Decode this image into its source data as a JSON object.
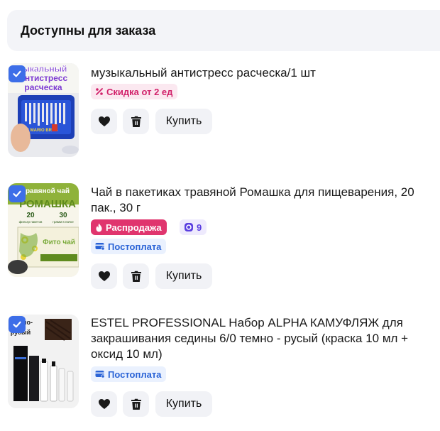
{
  "section": {
    "title": "Доступны для заказа"
  },
  "items": [
    {
      "title": "музыкальный антистресс расческа/1 шт",
      "badges": {
        "discount": "Скидка от 2 ед"
      },
      "image_text": {
        "line1": "ыкальный",
        "line2": "нтистресс",
        "line3": "расческа",
        "brand": "SUPER MARIO BROS"
      },
      "buy_label": "Купить"
    },
    {
      "title": "Чай в пакетиках травяной Ромашка для пищеварения, 20 пак., 30 г",
      "badges": {
        "sale": "Распродажа",
        "bonus": "9",
        "payment": "Постоплата"
      },
      "image_text": {
        "line1": "равяной чай",
        "line2": "РОМАШКА",
        "left_num": "20",
        "left_sub": "фильтр пакетов",
        "right_num": "30",
        "right_sub": "грамм в пачке",
        "box": "Фито чай"
      },
      "buy_label": "Купить"
    },
    {
      "title": "ESTEL PROFESSIONAL Набор ALPHA КАМУФЛЯЖ для закрашивания седины 6/0 темно - русый (краска 10 мл + оксид 10 мл)",
      "badges": {
        "payment": "Постоплата"
      },
      "image_text": {
        "line1": "но-",
        "line2": "русый"
      },
      "buy_label": "Купить"
    }
  ],
  "colors": {
    "accent": "#3d6ee8",
    "sale": "#e0356e",
    "discount_text": "#d1216a",
    "payment_text": "#2a63d6",
    "bonus_text": "#5a3ee0"
  },
  "icons": [
    "check-icon",
    "percent-icon",
    "flame-icon",
    "bonus-coin-icon",
    "postpay-card-icon",
    "heart-icon",
    "trash-icon"
  ]
}
